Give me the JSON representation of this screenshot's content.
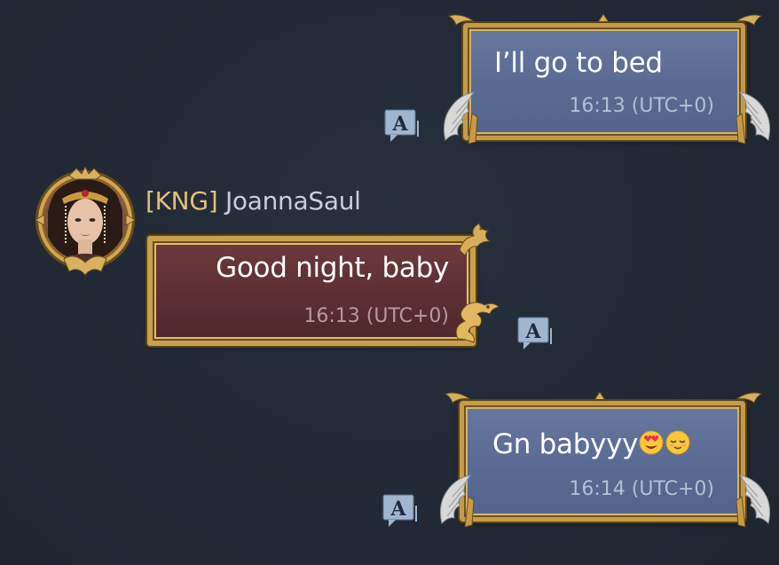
{
  "messages": [
    {
      "direction": "outgoing",
      "text": "I’ll go to bed",
      "time": "16:13 (UTC+0)"
    },
    {
      "direction": "incoming",
      "sender_tag": "[KNG]",
      "sender_name": "JoannaSaul",
      "text": "Good night, baby",
      "time": "16:13 (UTC+0)"
    },
    {
      "direction": "outgoing",
      "text": "Gn babyyy",
      "emojis": [
        "heart-eyes-face",
        "relieved-face"
      ],
      "time": "16:14 (UTC+0)"
    }
  ],
  "translate_button": {
    "icon": "translate-icon"
  },
  "colors": {
    "background": "#232a35",
    "outgoing_bubble": "#5f7198",
    "incoming_bubble": "#5d2f33",
    "gold_frame": "#c49b4a",
    "sender_tag": "#e2c07a",
    "sender_name": "#c9ced8"
  }
}
